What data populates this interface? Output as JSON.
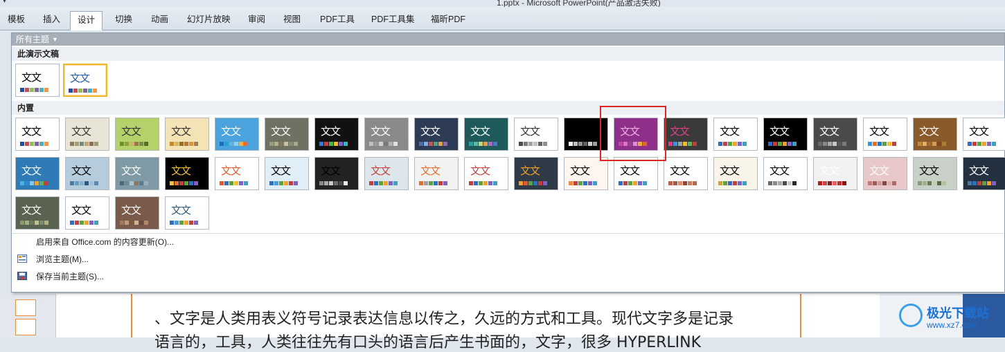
{
  "window": {
    "title": "1.pptx - Microsoft PowerPoint(产品激活失败)"
  },
  "ribbon": {
    "tabs": [
      {
        "label": "模板",
        "active": false
      },
      {
        "label": "插入",
        "active": false
      },
      {
        "label": "设计",
        "active": true
      },
      {
        "label": "切换",
        "active": false
      },
      {
        "label": "动画",
        "active": false
      },
      {
        "label": "幻灯片放映",
        "active": false
      },
      {
        "label": "审阅",
        "active": false
      },
      {
        "label": "视图",
        "active": false
      },
      {
        "label": "PDF工具",
        "active": false
      },
      {
        "label": "PDF工具集",
        "active": false
      },
      {
        "label": "福昕PDF",
        "active": false
      }
    ]
  },
  "gallery": {
    "filter_label": "所有主题",
    "section_current": "此演示文稿",
    "section_builtin": "内置",
    "theme_sample_text": "文文",
    "current_themes": [
      {
        "bg": "#ffffff",
        "fg": "#000000",
        "swatch": [
          "#1f4e9c",
          "#c0504d",
          "#9bbb59",
          "#8064a2",
          "#4bacc6",
          "#f79646"
        ]
      },
      {
        "bg": "#ffffff",
        "fg": "#1f5fa8",
        "swatch": [
          "#1f4e9c",
          "#c0504d",
          "#9bbb59",
          "#8064a2",
          "#4bacc6",
          "#f79646"
        ],
        "selected": true
      }
    ],
    "builtin_themes": [
      {
        "bg": "#ffffff",
        "fg": "#000000",
        "swatch": [
          "#1f4e9c",
          "#c0504d",
          "#9bbb59",
          "#8064a2",
          "#4bacc6",
          "#f79646"
        ]
      },
      {
        "bg": "#e9e5d6",
        "fg": "#333333",
        "swatch": [
          "#8a7a5c",
          "#a39a7c",
          "#6f8f7a",
          "#b7a57b",
          "#8c6f5c",
          "#9e9e6e"
        ]
      },
      {
        "bg": "#b3d26a",
        "fg": "#333333",
        "swatch": [
          "#6b8f2a",
          "#8aa33a",
          "#c8b56a",
          "#a2754a",
          "#7a8f4a",
          "#556b2f"
        ]
      },
      {
        "bg": "#f3e3b5",
        "fg": "#333333",
        "swatch": [
          "#c08a2e",
          "#e0b15a",
          "#9c6a2a",
          "#b07a3a",
          "#d59b3d",
          "#a67c52"
        ]
      },
      {
        "bg": "#4aa3dd",
        "fg": "#ffffff",
        "swatch": [
          "#1f6fb5",
          "#2f9ad8",
          "#5fb7e8",
          "#8fd0f0",
          "#f7b23b",
          "#e86b2e"
        ]
      },
      {
        "bg": "#6f7262",
        "fg": "#ffffff",
        "swatch": [
          "#9b9b7a",
          "#b5b08a",
          "#7a7a6a",
          "#c8c09a",
          "#8a8a72",
          "#a5a58a"
        ]
      },
      {
        "bg": "#111111",
        "fg": "#ffffff",
        "swatch": [
          "#2e7bcf",
          "#d23c3c",
          "#4fb64f",
          "#e8c12f",
          "#8b5ac0",
          "#38b2c4"
        ]
      },
      {
        "bg": "#8a8a8a",
        "fg": "#ffffff",
        "swatch": [
          "#c0c0c0",
          "#9a9a9a",
          "#d0d0d0",
          "#7a7a7a",
          "#b0b0b0",
          "#e0e0e0"
        ]
      },
      {
        "bg": "#2e3b55",
        "fg": "#ffffff",
        "swatch": [
          "#4a6fa5",
          "#8fa9d6",
          "#c05a5a",
          "#5aa07a",
          "#d6a54a",
          "#8a6ab0"
        ]
      },
      {
        "bg": "#1f5a5a",
        "fg": "#ffffff",
        "swatch": [
          "#2e9c9c",
          "#58b8a8",
          "#c0d87a",
          "#e0a050",
          "#a070c0",
          "#5078c0"
        ]
      },
      {
        "bg": "#ffffff",
        "fg": "#333333",
        "swatch": [
          "#4a4a4a",
          "#7a7a7a",
          "#a0a0a0",
          "#c0c0c0",
          "#606060",
          "#909090"
        ]
      },
      {
        "bg": "#000000",
        "fg": "#000000",
        "swatch": [
          "#ffffff",
          "#c0c0c0",
          "#909090",
          "#606060",
          "#d0d0d0",
          "#a0a0a0"
        ]
      },
      {
        "bg": "#8e2f8a",
        "fg": "#f0b0e0",
        "swatch": [
          "#c04aa0",
          "#e070c0",
          "#a03a90",
          "#d890d0",
          "#f0b02e",
          "#e06a2e"
        ]
      },
      {
        "bg": "#3a3a3a",
        "fg": "#e0408a",
        "swatch": [
          "#e0408a",
          "#2e9ad8",
          "#a0a0a0",
          "#f0c030",
          "#60b060",
          "#c04040"
        ]
      },
      {
        "bg": "#ffffff",
        "fg": "#000000",
        "swatch": [
          "#2e6fc0",
          "#c04040",
          "#60a040",
          "#f0a030",
          "#8060c0",
          "#40a0c0"
        ]
      },
      {
        "bg": "#000000",
        "fg": "#ffffff",
        "swatch": [
          "#2e6fc0",
          "#c04040",
          "#60a040",
          "#f0a030",
          "#8060c0",
          "#40a0c0"
        ]
      },
      {
        "bg": "#4a4a4a",
        "fg": "#ffffff",
        "swatch": [
          "#6a6a6a",
          "#8a8a8a",
          "#aaaaaa",
          "#cacaca",
          "#5a5a5a",
          "#7a7a7a"
        ]
      },
      {
        "bg": "#ffffff",
        "fg": "#000000",
        "swatch": [
          "#2e9ad8",
          "#e86b2e",
          "#2e6fc0",
          "#60a040",
          "#f0c030",
          "#c04040"
        ]
      },
      {
        "bg": "#8a5a2a",
        "fg": "#ffffff",
        "swatch": [
          "#c08a3a",
          "#e0b060",
          "#a06a2a",
          "#d09a4a",
          "#7a4a1a",
          "#b07a3a"
        ]
      },
      {
        "bg": "#ffffff",
        "fg": "#000000",
        "swatch": [
          "#2e6fc0",
          "#c04040",
          "#60a040",
          "#f0a030",
          "#8060c0",
          "#40a0c0"
        ]
      },
      {
        "bg": "#2e7bb5",
        "fg": "#ffffff",
        "swatch": [
          "#4ab0e0",
          "#2e8ad0",
          "#80c8f0",
          "#f0a030",
          "#60b060",
          "#c04040"
        ]
      },
      {
        "bg": "#b5ccdd",
        "fg": "#000000",
        "swatch": [
          "#4a7aa0",
          "#6a9ac0",
          "#8ab0d0",
          "#2e5a80",
          "#a0c0d8",
          "#5a8ab0"
        ]
      },
      {
        "bg": "#7f9aa5",
        "fg": "#ffffff",
        "swatch": [
          "#4a6a7a",
          "#6a8a9a",
          "#aac0c8",
          "#8a7a5a",
          "#5a7a8a",
          "#9ab0b8"
        ]
      },
      {
        "bg": "#000000",
        "fg": "#f0c040",
        "swatch": [
          "#f0c040",
          "#e07030",
          "#c04040",
          "#60a040",
          "#2e6fc0",
          "#8060c0"
        ]
      },
      {
        "bg": "#ffffff",
        "fg": "#e05a2a",
        "swatch": [
          "#e05a2a",
          "#2e6fc0",
          "#60a040",
          "#f0c030",
          "#8060c0",
          "#40a0c0"
        ]
      },
      {
        "bg": "#e0eef8",
        "fg": "#000000",
        "swatch": [
          "#2e6fc0",
          "#4a9ad8",
          "#60a040",
          "#f0a030",
          "#c04040",
          "#8060c0"
        ]
      },
      {
        "bg": "#222222",
        "fg": "#000000",
        "swatch": [
          "#8a8a8a",
          "#aaaaaa",
          "#cacaca",
          "#6a6a6a",
          "#4a4a4a",
          "#eaeaea"
        ]
      },
      {
        "bg": "#dde6ea",
        "fg": "#c04040",
        "swatch": [
          "#c04040",
          "#2e6fc0",
          "#60a040",
          "#f0a030",
          "#8060c0",
          "#40a0c0"
        ]
      },
      {
        "bg": "#f2f2f2",
        "fg": "#e07030",
        "swatch": [
          "#e07030",
          "#a0a0a0",
          "#60a040",
          "#2e6fc0",
          "#c04040",
          "#8060c0"
        ]
      },
      {
        "bg": "#ffffff",
        "fg": "#c04040",
        "swatch": [
          "#c04040",
          "#2e6fc0",
          "#60a040",
          "#f0a030",
          "#8060c0",
          "#40a0c0"
        ]
      },
      {
        "bg": "#2e3a45",
        "fg": "#f0a030",
        "swatch": [
          "#f0a030",
          "#e05a2a",
          "#60a040",
          "#2e6fc0",
          "#c04040",
          "#8060c0"
        ]
      },
      {
        "bg": "#fdf5ee",
        "fg": "#000000",
        "swatch": [
          "#f08a3a",
          "#c04040",
          "#60a040",
          "#2e6fc0",
          "#8060c0",
          "#40a0c0"
        ]
      },
      {
        "bg": "#ffffff",
        "fg": "#000000",
        "swatch": [
          "#2e6fc0",
          "#c04040",
          "#60a040",
          "#f0a030",
          "#8060c0",
          "#40a0c0"
        ]
      },
      {
        "bg": "#ffffff",
        "fg": "#000000",
        "swatch": [
          "#c0604a",
          "#a05a4a",
          "#e08a6a",
          "#8a4a3a",
          "#d07a5a",
          "#b06a5a"
        ]
      },
      {
        "bg": "#f8f4e8",
        "fg": "#000000",
        "swatch": [
          "#d0a040",
          "#60a040",
          "#2e6fc0",
          "#c04040",
          "#8060c0",
          "#40a0c0"
        ]
      },
      {
        "bg": "#ffffff",
        "fg": "#000000",
        "swatch": [
          "#6a6a6a",
          "#8a8a8a",
          "#aaaaaa",
          "#4a4a4a",
          "#cacaca",
          "#2a2a2a"
        ]
      },
      {
        "bg": "#f2f2f2",
        "fg": "#ffffff",
        "swatch": [
          "#b02020",
          "#d04040",
          "#802020",
          "#f06060",
          "#c03030",
          "#901010"
        ]
      },
      {
        "bg": "#e8c8c8",
        "fg": "#ffffff",
        "swatch": [
          "#c07a7a",
          "#a05a5a",
          "#d09a9a",
          "#804a4a",
          "#e0b0b0",
          "#b06a6a"
        ]
      },
      {
        "bg": "#c8d0c8",
        "fg": "#000000",
        "swatch": [
          "#8a9a7a",
          "#a0b090",
          "#6a7a5a",
          "#c0d0b0",
          "#5a6a4a",
          "#b0c0a0"
        ]
      },
      {
        "bg": "#223040",
        "fg": "#ffffff",
        "swatch": [
          "#4a7aa0",
          "#2e6fc0",
          "#c04040",
          "#60a040",
          "#f0a030",
          "#8060c0"
        ]
      },
      {
        "bg": "#5a6250",
        "fg": "#ffffff",
        "swatch": [
          "#8a9a6a",
          "#a0b080",
          "#6a7a5a",
          "#c0c090",
          "#7a8a6a",
          "#b0b080"
        ]
      },
      {
        "bg": "#ffffff",
        "fg": "#000000",
        "swatch": [
          "#2e6fc0",
          "#c04040",
          "#60a040",
          "#f0a030",
          "#8060c0",
          "#40a0c0"
        ]
      },
      {
        "bg": "#7a5a4a",
        "fg": "#ffffff",
        "swatch": [
          "#a07a5a",
          "#c09a7a",
          "#805a3a",
          "#d0b090",
          "#6a4a3a",
          "#b08a6a"
        ]
      },
      {
        "bg": "#ffffff",
        "fg": "#2e5a80",
        "swatch": [
          "#2e6fc0",
          "#4a9ad8",
          "#60a040",
          "#f0a030",
          "#c04040",
          "#8060c0"
        ]
      }
    ],
    "menu": [
      {
        "label": "启用来自 Office.com 的内容更新(O)...",
        "icon": "none"
      },
      {
        "label": "浏览主题(M)...",
        "icon": "browse-themes-icon"
      },
      {
        "label": "保存当前主题(S)...",
        "icon": "save-theme-icon"
      }
    ]
  },
  "document": {
    "line1": "、文字是人类用表义符号记录表达信息以传之，久远的方式和工具。现代文字多是记录",
    "line2": "语言的，工具，人类往往先有口头的语言后产生书面的，文字，很多 HYPERLINK"
  },
  "watermark": {
    "brand": "极光下载站",
    "url": "www.xz7.com"
  }
}
